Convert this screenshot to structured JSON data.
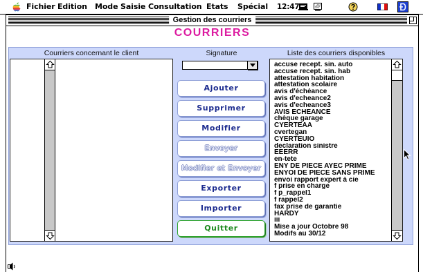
{
  "menubar": {
    "items": [
      "Fichier",
      "Edition",
      "Mode",
      "Saisie",
      "Consultation",
      "Etats",
      "Spécial"
    ],
    "clock": "12:47",
    "icons": [
      "apple-icon",
      "notebook-icon",
      "computer-icon",
      "help-icon",
      "french-flag-icon",
      "application-icon"
    ]
  },
  "window": {
    "title": "Gestion des courriers",
    "heading": "COURRIERS"
  },
  "client_letters": {
    "header": "Courriers concernant le client",
    "items": []
  },
  "signature": {
    "header": "Signature",
    "selected_value": ""
  },
  "actions": [
    {
      "label": "Ajouter",
      "enabled": true
    },
    {
      "label": "Supprimer",
      "enabled": true
    },
    {
      "label": "Modifier",
      "enabled": true
    },
    {
      "label": "Envoyer",
      "enabled": false
    },
    {
      "label": "Modifier et Envoyer",
      "enabled": false
    },
    {
      "label": "Exporter",
      "enabled": true
    },
    {
      "label": "Importer",
      "enabled": true
    },
    {
      "label": "Quitter",
      "enabled": true
    }
  ],
  "available_letters": {
    "header": "Liste des courriers disponibles",
    "items": [
      "accuse recept. sin. auto",
      "accuse recept. sin. hab",
      "attestation habitation",
      "attestation scolaire",
      "avis d'échéance",
      "avis d'echeance2",
      "avis d'echeance3",
      "AVIS ECHEANCE",
      "chèque garage",
      "CYERTEAA",
      "cvertegan",
      "CYERTEUIO",
      "declaration sinistre",
      "EEERR",
      "en-tete",
      "ENY DE PIECE AYEC PRIME",
      "ENYOI DE PIECE SANS PRIME",
      "envoi rapport expert à cie",
      "f prise en charge",
      "f p_rappel1",
      "f rappel2",
      "fax prise de garantie",
      "HARDY",
      "iii",
      "Mise a jour Octobre 98",
      "Modifs au 30/12"
    ]
  },
  "colors": {
    "heading": "#dc1aa0",
    "panel": "#cdd8fb",
    "button_text": "#1d2c8f",
    "quit": "#1f8a1f"
  }
}
